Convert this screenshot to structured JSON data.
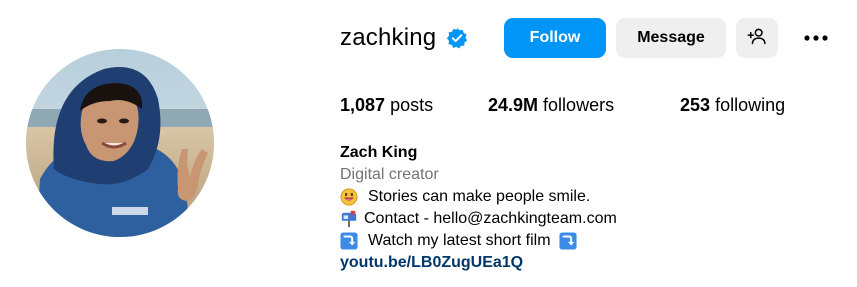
{
  "profile": {
    "username": "zachking",
    "verified_icon": "verified-badge-icon",
    "actions": {
      "follow_label": "Follow",
      "message_label": "Message",
      "suggest_icon": "add-person-icon",
      "more_icon": "more-horizontal-icon"
    },
    "stats": {
      "posts_count": "1,087",
      "posts_label": "posts",
      "followers_count": "24.9M",
      "followers_label": "followers",
      "following_count": "253",
      "following_label": "following"
    },
    "bio": {
      "name": "Zach King",
      "category": "Digital creator",
      "line1_icon": "grinning-face-icon",
      "line1_text": "Stories can make people smile.",
      "line2_icon": "mailbox-icon",
      "line2_text": "Contact - hello@zachkingteam.com",
      "line3_icon": "right-arrow-curving-down-icon",
      "line3_text": "Watch my latest short film",
      "link": "youtu.be/LB0ZugUEa1Q"
    }
  },
  "colors": {
    "follow_blue": "#0095f6",
    "button_gray": "#efefef",
    "category_gray": "#737373",
    "link_navy": "#00376b",
    "verified_blue": "#0095f6"
  }
}
